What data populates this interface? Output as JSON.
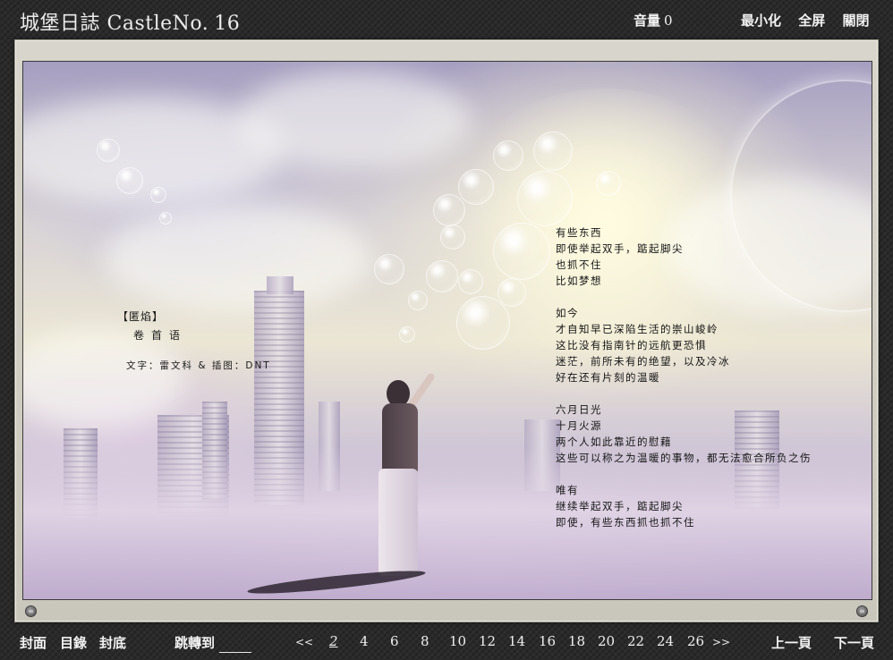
{
  "app": {
    "title": "城堡日誌 CastleNo.",
    "issue": "16"
  },
  "volume": {
    "label": "音量",
    "value": "0"
  },
  "window_controls": {
    "minimize": "最小化",
    "fullscreen": "全屏",
    "close": "關閉"
  },
  "article": {
    "chapter": "【匿焰】",
    "subtitle": "卷首语",
    "credits": "文字：雷文科 & 插图：DNT",
    "poem": [
      "有些东西",
      "即使举起双手，踮起脚尖",
      "也抓不住",
      "比如梦想",
      "",
      "如今",
      "才自知早已深陷生活的崇山峻岭",
      "这比没有指南针的远航更恐惧",
      "迷茫，前所未有的绝望，以及冷冰",
      "好在还有片刻的温暖",
      "",
      "六月日光",
      "十月火源",
      "两个人如此靠近的慰藉",
      "这些可以称之为温暖的事物，都无法愈合所负之伤",
      "",
      "唯有",
      "继续举起双手，踮起脚尖",
      "即使，有些东西抓也抓不住"
    ]
  },
  "corner_buttons": {
    "left_glyph": "≡",
    "right_glyph": "≡"
  },
  "bottom_nav": {
    "cover": "封面",
    "contents": "目錄",
    "back_cover": "封底",
    "goto_label": "跳轉到",
    "goto_value": "",
    "prev_arrow": "<<",
    "next_arrow": ">>",
    "pages": [
      "2",
      "4",
      "6",
      "8",
      "10",
      "12",
      "14",
      "16",
      "18",
      "20",
      "22",
      "24",
      "26"
    ],
    "current_page": "2",
    "prev_page": "上一頁",
    "next_page": "下一頁"
  },
  "colors": {
    "background": "#2a2a2a",
    "frame": "#d8d6cc",
    "text_light": "#f2f2f2",
    "text_dark": "#151515"
  }
}
